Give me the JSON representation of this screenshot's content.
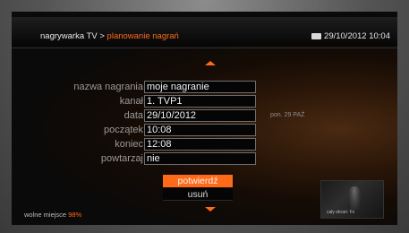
{
  "header": {
    "breadcrumb_root": "nagrywarka TV",
    "breadcrumb_sep": " > ",
    "breadcrumb_current": "planowanie nagrań",
    "datetime": "29/10/2012 10:04"
  },
  "form": {
    "rows": [
      {
        "label": "nazwa nagrania",
        "value": "moje nagranie",
        "hint": ""
      },
      {
        "label": "kanał",
        "value": "1. TVP1",
        "hint": ""
      },
      {
        "label": "data",
        "value": "29/10/2012",
        "hint": "pon. 29 PAŹ"
      },
      {
        "label": "początek",
        "value": "10:08",
        "hint": ""
      },
      {
        "label": "koniec",
        "value": "12:08",
        "hint": ""
      },
      {
        "label": "powtarzaj",
        "value": "nie",
        "hint": ""
      }
    ]
  },
  "buttons": {
    "confirm": "potwierdź",
    "delete": "usuń"
  },
  "footer": {
    "free_space_label": "wolne miejsce",
    "free_space_value": "98%",
    "preview_caption": "cały ekran: Fx"
  },
  "colors": {
    "accent": "#ff6a1a",
    "label": "#9a9a9a",
    "field_border": "#6e6e6e"
  },
  "icons": {
    "scroll_up": "triangle-up-icon",
    "scroll_down": "triangle-down-icon",
    "tv": "tv-icon"
  }
}
